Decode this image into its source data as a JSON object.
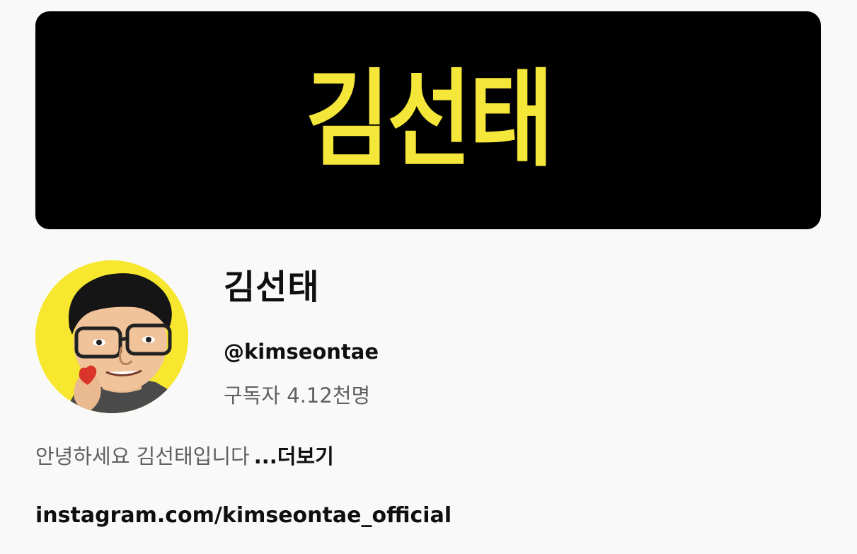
{
  "banner": {
    "logo_text": "김선태",
    "background_color": "#000000",
    "logo_color": "#f5e63a"
  },
  "channel": {
    "name": "김선태",
    "handle": "@kimseontae",
    "subscribers": "구독자 4.12천명"
  },
  "description": {
    "text": "안녕하세요 김선태입니다",
    "more_label": "...더보기"
  },
  "link": {
    "text": "instagram.com/kimseontae_official"
  },
  "colors": {
    "page_background": "#f9f9f9",
    "primary_text": "#0f0f0f",
    "secondary_text": "#606060",
    "avatar_background": "#f7e72e"
  }
}
